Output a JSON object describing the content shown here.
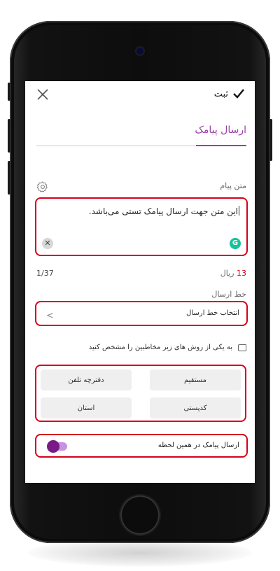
{
  "header": {
    "save_label": "ثبت",
    "close_icon": "close-icon",
    "check_icon": "check-icon"
  },
  "tab": {
    "label": "ارسال پیامک"
  },
  "message": {
    "label": "متن پیام",
    "text": "این متن جهت ارسال پیامک تستی می‌باشد.",
    "cost_value": "13",
    "cost_unit": "ریال",
    "char_counter": "1/37"
  },
  "line": {
    "label": "خط ارسال",
    "placeholder": "انتخاب خط ارسال"
  },
  "recipients": {
    "hint": "به یکی از روش های زیر مخاطبین را مشخص کنید",
    "options": [
      "مستقیم",
      "دفترچه تلفن",
      "کدپستی",
      "استان"
    ]
  },
  "send_now": {
    "label": "ارسال پیامک در همین لحظه",
    "enabled": true
  },
  "colors": {
    "accent": "#9a3fa8",
    "highlight_border": "#d6001c",
    "toggle_knob": "#7a1a86"
  }
}
